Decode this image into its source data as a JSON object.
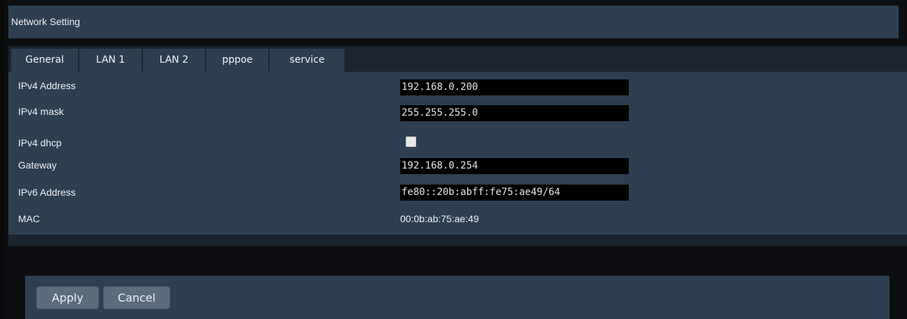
{
  "header": {
    "title": "Network Setting"
  },
  "tabs": [
    {
      "label": "General"
    },
    {
      "label": "LAN 1"
    },
    {
      "label": "LAN 2"
    },
    {
      "label": "pppoe"
    },
    {
      "label": "service"
    }
  ],
  "active_tab": "LAN 1",
  "form": {
    "ipv4_address": {
      "label": "IPv4 Address",
      "value": "192.168.0.200"
    },
    "ipv4_mask": {
      "label": "IPv4 mask",
      "value": "255.255.255.0"
    },
    "ipv4_dhcp": {
      "label": "IPv4 dhcp",
      "checked": false
    },
    "gateway": {
      "label": "Gateway",
      "value": "192.168.0.254"
    },
    "ipv6_address": {
      "label": "IPv6 Address",
      "value": "fe80::20b:abff:fe75:ae49/64"
    },
    "mac": {
      "label": "MAC",
      "value": "00:0b:ab:75:ae:49"
    }
  },
  "actions": {
    "apply_label": "Apply",
    "cancel_label": "Cancel"
  },
  "colors": {
    "panel": "#2e3f52",
    "strip": "#1b2530",
    "background": "#0d0f12",
    "button": "#5b6c7d"
  }
}
